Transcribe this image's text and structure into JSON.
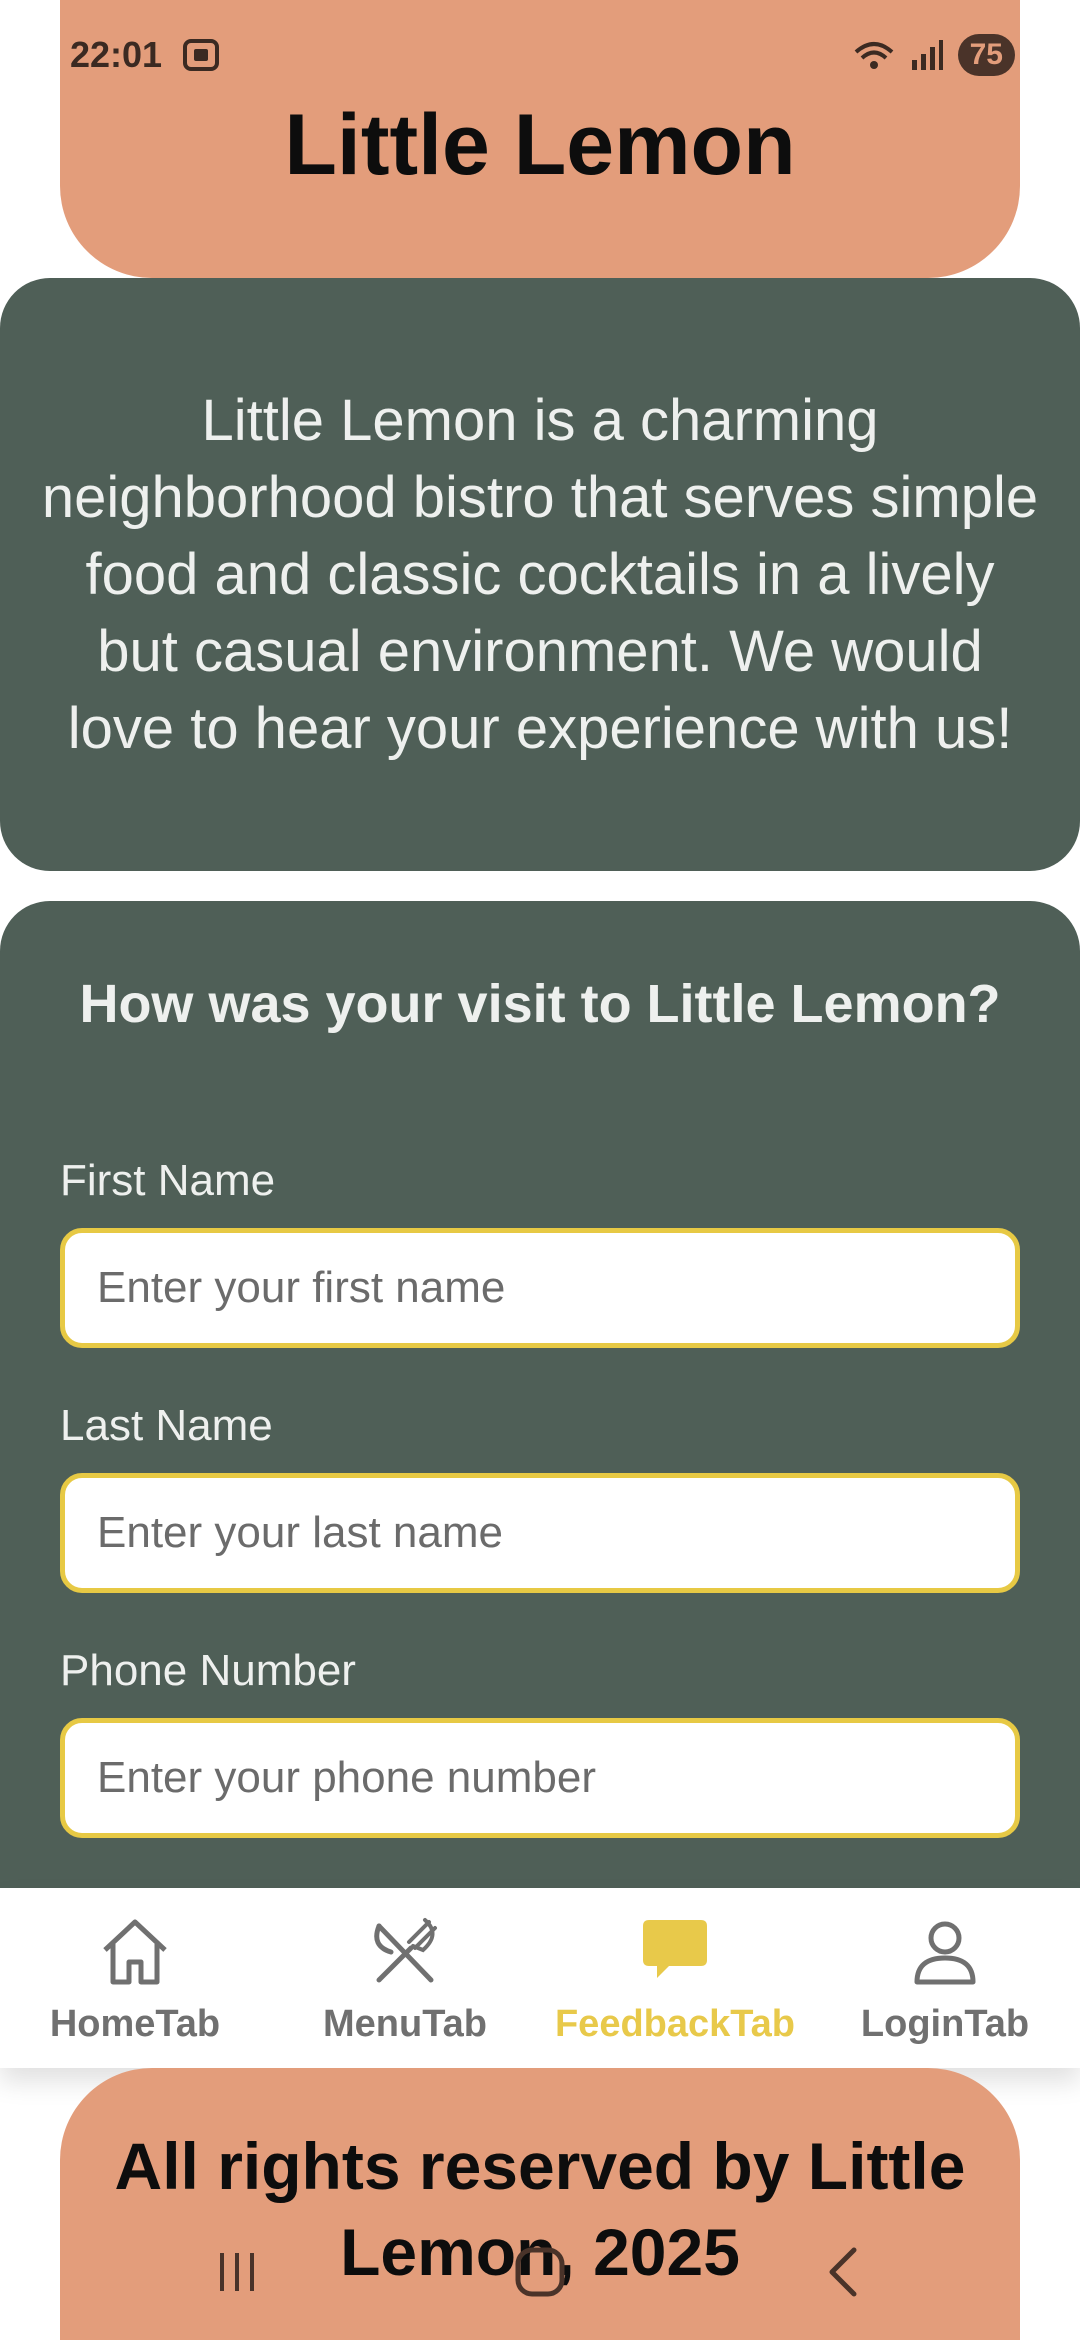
{
  "status_bar": {
    "time": "22:01",
    "battery": "75"
  },
  "header": {
    "title": "Little Lemon"
  },
  "description": "Little Lemon is a charming neighborhood bistro that serves simple food and classic cocktails in a lively but casual environment. We would love to hear your experience with us!",
  "form": {
    "heading": "How was your visit to Little Lemon?",
    "fields": [
      {
        "label": "First Name",
        "placeholder": "Enter your first name"
      },
      {
        "label": "Last Name",
        "placeholder": "Enter your last name"
      },
      {
        "label": "Phone Number",
        "placeholder": "Enter your phone number"
      }
    ]
  },
  "nav": {
    "items": [
      {
        "label": "HomeTab",
        "icon": "home-icon"
      },
      {
        "label": "MenuTab",
        "icon": "utensils-icon"
      },
      {
        "label": "FeedbackTab",
        "icon": "chat-bubble-icon",
        "active": true
      },
      {
        "label": "LoginTab",
        "icon": "user-icon"
      }
    ]
  },
  "footer": {
    "text": "All rights reserved by Little Lemon, 2025"
  },
  "colors": {
    "header_bg": "#e39d7b",
    "card_bg": "#4f5f57",
    "input_border": "#e7c944",
    "active_tab": "#e8c94a",
    "inactive_tab": "#707070"
  }
}
